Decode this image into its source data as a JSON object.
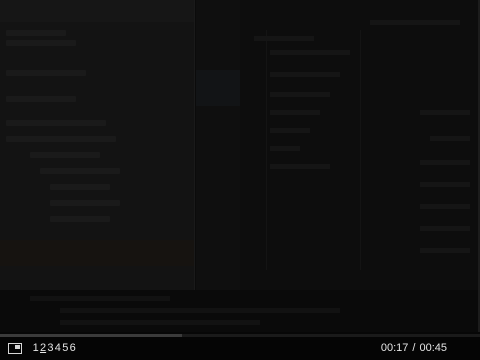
{
  "player": {
    "chapters": [
      "1",
      "2",
      "3",
      "4",
      "5",
      "6"
    ],
    "active_chapter_index": 1,
    "current_time": "00:17",
    "separator": "/",
    "total_time": "00:45",
    "progress_fraction": 0.38,
    "fullscreen_icon": "fullscreen-icon"
  },
  "colors": {
    "text": "#e6e6e6",
    "background": "#050505"
  }
}
